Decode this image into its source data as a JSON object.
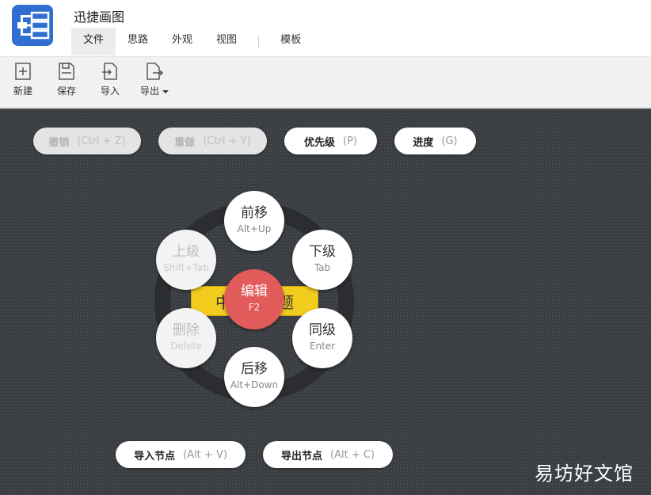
{
  "app": {
    "title": "迅捷画图",
    "logo_icon": "mindmap-logo-icon",
    "brand_color": "#2e6fd0"
  },
  "menu": [
    {
      "label": "文件",
      "active": true
    },
    {
      "label": "思路",
      "active": false
    },
    {
      "label": "外观",
      "active": false
    },
    {
      "label": "视图",
      "active": false
    },
    {
      "label": "模板",
      "active": false
    }
  ],
  "toolbar": [
    {
      "label": "新建",
      "icon": "new-file-icon"
    },
    {
      "label": "保存",
      "icon": "save-icon"
    },
    {
      "label": "导入",
      "icon": "import-icon"
    },
    {
      "label": "导出",
      "icon": "export-icon"
    }
  ],
  "actions": {
    "undo": {
      "label": "撤销",
      "key": "(Ctrl + Z)",
      "enabled": false
    },
    "redo": {
      "label": "重做",
      "key": "(Ctrl + Y)",
      "enabled": false
    },
    "priority": {
      "label": "优先级",
      "key": "(P)",
      "enabled": true
    },
    "progress": {
      "label": "进度",
      "key": "(G)",
      "enabled": true
    },
    "import_node": {
      "label": "导入节点",
      "key": "(Alt + V)",
      "enabled": true
    },
    "export_node": {
      "label": "导出节点",
      "key": "(Alt + C)",
      "enabled": true
    }
  },
  "topic": {
    "left_text": "中",
    "right_text": "题",
    "color": "#f2cd1e"
  },
  "radial_menu": {
    "move_up": {
      "label": "前移",
      "key": "Alt+Up"
    },
    "child": {
      "label": "下级",
      "key": "Tab"
    },
    "sibling": {
      "label": "同级",
      "key": "Enter"
    },
    "move_down": {
      "label": "后移",
      "key": "Alt+Down"
    },
    "delete": {
      "label": "删除",
      "key": "Delete"
    },
    "parent": {
      "label": "上级",
      "key": "Shift+Tab"
    },
    "edit": {
      "label": "编辑",
      "key": "F2",
      "color": "#e25b5b"
    }
  },
  "watermark": "易坊好文馆"
}
